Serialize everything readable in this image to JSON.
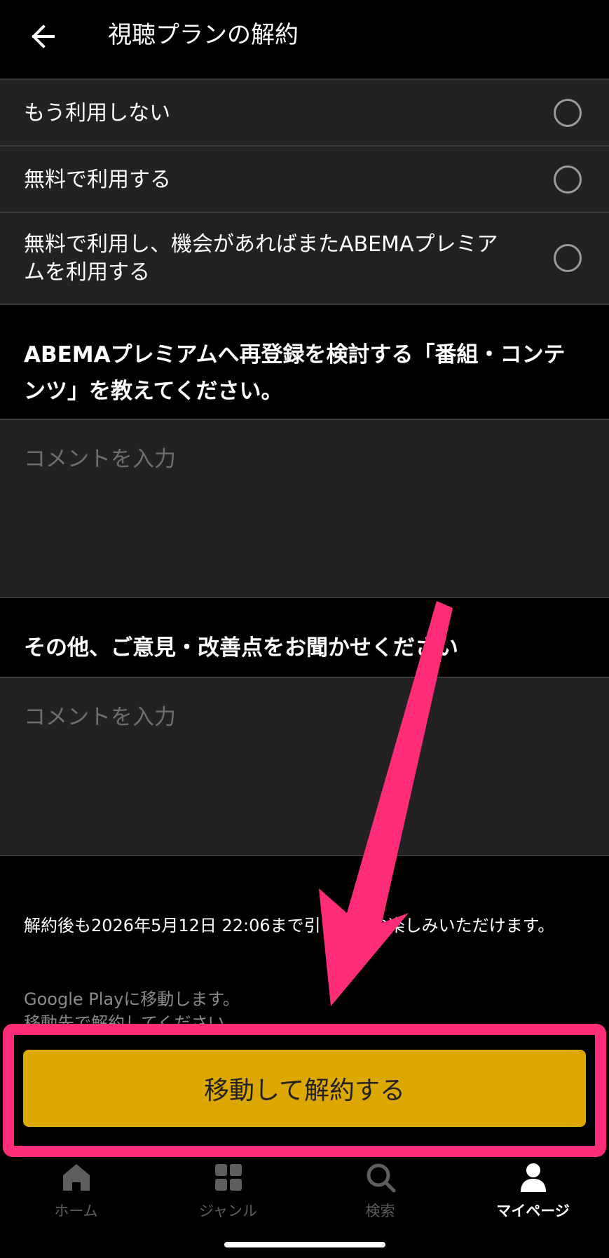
{
  "header": {
    "title": "視聴プランの解約",
    "back_icon": "arrow-left-icon"
  },
  "options": [
    {
      "label": "もう利用しない",
      "selected": false
    },
    {
      "label": "無料で利用する",
      "selected": false
    },
    {
      "label": "無料で利用し、機会があればまたABEMAプレミアムを利用する",
      "selected": false
    }
  ],
  "questions": {
    "q1": "ABEMAプレミアムへ再登録を検討する「番組・コンテンツ」を教えてください。",
    "q2": "その他、ご意見・改善点をお聞かせください"
  },
  "comments": {
    "placeholder1": "コメントを入力",
    "placeholder2": "コメントを入力",
    "value1": "",
    "value2": ""
  },
  "info": {
    "notice": "解約後も2026年5月12日 22:06まで引き続きお楽しみいただけます。",
    "google_play_line1": "Google Playに移動します。",
    "google_play_line2": "移動先で解約してください。"
  },
  "primary_button": {
    "label": "移動して解約する"
  },
  "bottom_nav": [
    {
      "label": "ホーム",
      "icon": "home-icon",
      "active": false
    },
    {
      "label": "ジャンル",
      "icon": "grid-icon",
      "active": false
    },
    {
      "label": "検索",
      "icon": "search-icon",
      "active": false
    },
    {
      "label": "マイページ",
      "icon": "person-icon",
      "active": true
    }
  ],
  "colors": {
    "background": "#000000",
    "surface": "#222222",
    "accent_button": "#dca800",
    "annotation": "#ff2d77"
  }
}
